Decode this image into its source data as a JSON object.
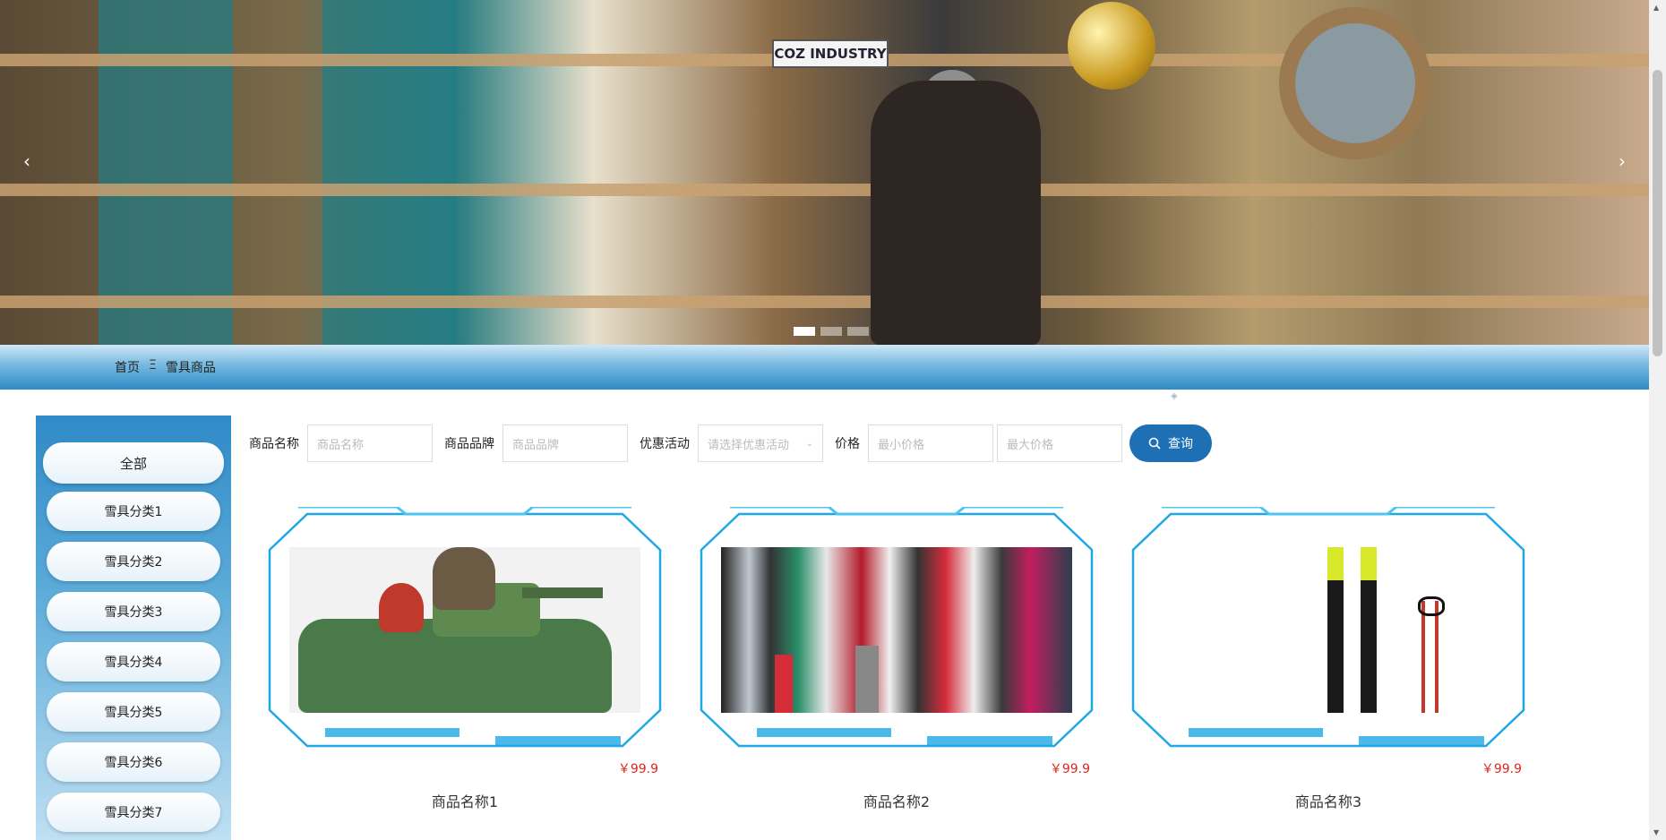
{
  "banner": {
    "shop_sign": "COZ INDUSTRY",
    "prev_icon": "chevron-left-icon",
    "next_icon": "chevron-right-icon",
    "slides": 3,
    "active_slide": 1
  },
  "breadcrumb": {
    "home": "首页",
    "separator": "Ξ",
    "current": "雪具商品"
  },
  "sidebar": {
    "all_label": "全部",
    "items": [
      "雪具分类1",
      "雪具分类2",
      "雪具分类3",
      "雪具分类4",
      "雪具分类5",
      "雪具分类6",
      "雪具分类7"
    ]
  },
  "search": {
    "name_label": "商品名称",
    "name_placeholder": "商品名称",
    "brand_label": "商品品牌",
    "brand_placeholder": "商品品牌",
    "promo_label": "优惠活动",
    "promo_placeholder": "请选择优惠活动",
    "price_label": "价格",
    "min_placeholder": "最小价格",
    "max_placeholder": "最大价格",
    "button_label": "查询",
    "button_icon": "search-icon"
  },
  "products": [
    {
      "name": "商品名称1",
      "price": "￥99.9",
      "image": "tank-ride-photo"
    },
    {
      "name": "商品名称2",
      "price": "￥99.9",
      "image": "skis-rack-photo"
    },
    {
      "name": "商品名称3",
      "price": "￥99.9",
      "image": "skis-and-poles-photo"
    }
  ],
  "colors": {
    "accent": "#1f6fb5",
    "bar": "#2f8ac7",
    "price": "#e0261c",
    "frame": "#1fa8e6"
  }
}
